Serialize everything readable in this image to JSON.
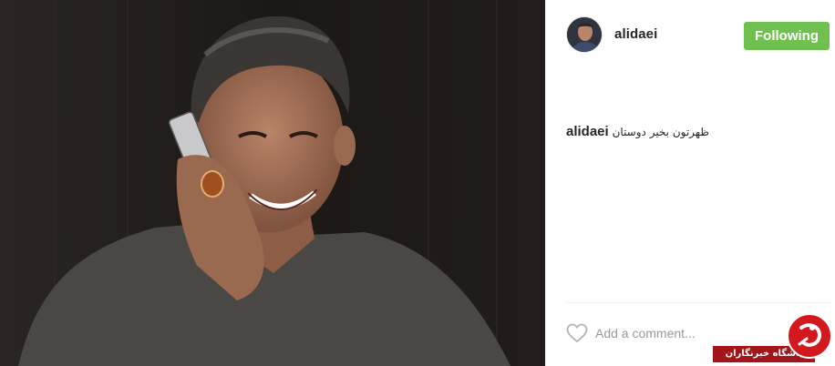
{
  "post": {
    "photo_alt": "Man smiling while talking on a mobile phone",
    "username": "alidaei",
    "follow_label": "Following",
    "caption_user": "alidaei",
    "caption_text": "ظهرتون بخیر دوستان",
    "comment_placeholder": "Add a comment...",
    "colors": {
      "follow_button": "#70c050",
      "text": "#262626",
      "placeholder": "#9a9a9a",
      "watermark_red": "#d4191e"
    }
  },
  "watermark": {
    "text": "باشگاه خبرنگاران"
  }
}
